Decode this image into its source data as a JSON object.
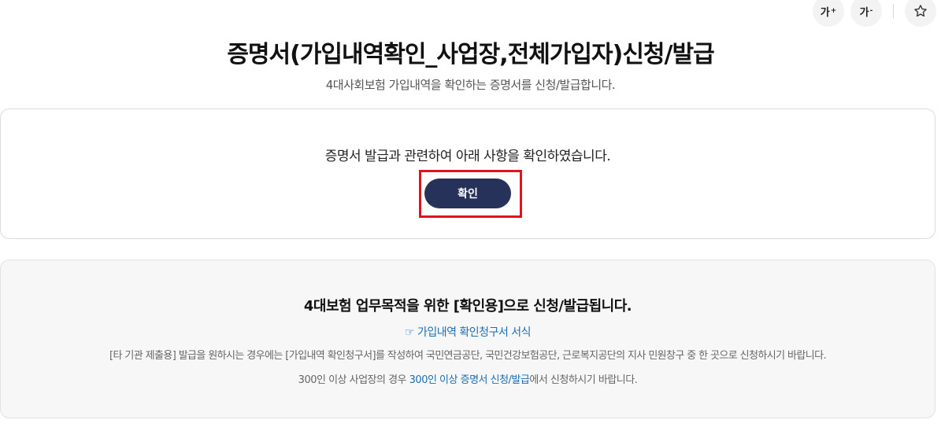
{
  "toolbar": {
    "font_increase_label": "가",
    "font_increase_sign": "+",
    "font_decrease_label": "가",
    "font_decrease_sign": "-",
    "favorite_icon": "star-icon"
  },
  "header": {
    "title": "증명서(가입내역확인_사업장,전체가입자)신청/발급",
    "subtitle": "4대사회보험 가입내역을 확인하는 증명서를 신청/발급합니다."
  },
  "confirm": {
    "text": "증명서 발급과 관련하여 아래 사항을 확인하였습니다.",
    "button_label": "확인",
    "button_color": "#27325a",
    "highlight_color": "#e0141e"
  },
  "info": {
    "heading": "4대보험 업무목적을 위한 [확인용]으로 신청/발급됩니다.",
    "form_link_icon": "☞",
    "form_link_label": "가입내역 확인청구서 서식",
    "notice_1": "[타 기관 제출용] 발급을 원하시는 경우에는 [가입내역 확인청구서]를 작성하여 국민연금공단, 국민건강보험공단, 근로복지공단의 지사 민원창구 중 한 곳으로 신청하시기 바랍니다.",
    "notice_2_prefix": "300인 이상 사업장의 경우 ",
    "notice_2_link": "300인 이상 증명서 신청/발급",
    "notice_2_suffix": "에서 신청하시기 바랍니다.",
    "link_color": "#1a6fb5"
  }
}
